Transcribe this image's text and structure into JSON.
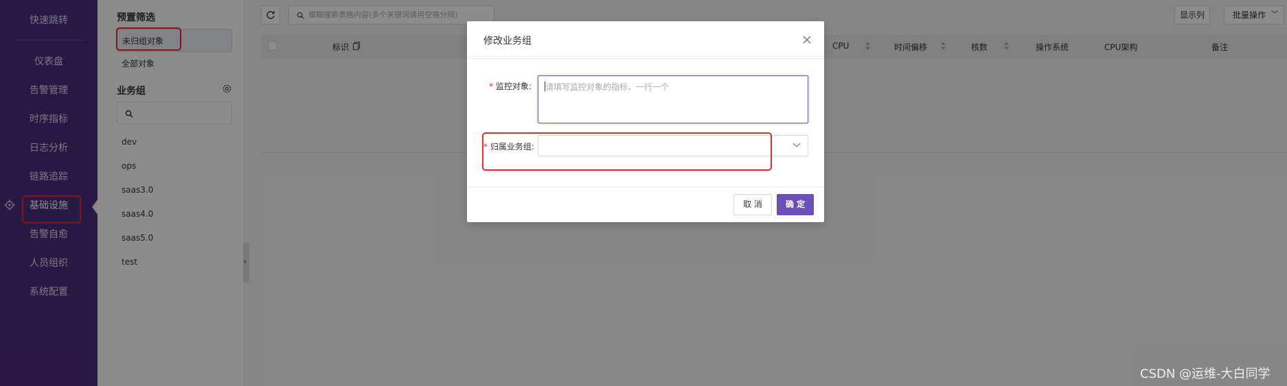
{
  "nav": {
    "items": [
      "快速跳转",
      "仪表盘",
      "告警管理",
      "时序指标",
      "日志分析",
      "链路追踪",
      "基础设施",
      "告警自愈",
      "人员组织",
      "系统配置"
    ]
  },
  "filters": {
    "preset_title": "预置筛选",
    "options": [
      "未归组对象",
      "全部对象"
    ],
    "group_title": "业务组",
    "groups": [
      "dev",
      "ops",
      "saas3.0",
      "saas4.0",
      "saas5.0",
      "test"
    ]
  },
  "toolbar": {
    "search_placeholder": "模糊搜索表格内容(多个关键词请用空格分隔)",
    "show_columns": "显示列",
    "batch_ops": "批量操作"
  },
  "table": {
    "headers": [
      "标识",
      "CPU",
      "时间偏移",
      "核数",
      "操作系统",
      "CPU架构",
      "备注"
    ]
  },
  "modal": {
    "title": "修改业务组",
    "field1_label": "监控对象:",
    "field1_placeholder": "请填写监控对象的指标，一行一个",
    "field2_label": "归属业务组:",
    "cancel": "取 消",
    "ok": "确 定",
    "required_mark": "*"
  },
  "watermark": "CSDN @运维-大白同学",
  "colors": {
    "sidebar": "#4a2e7c",
    "primary": "#6a4fb6",
    "highlight": "#e8282c"
  }
}
